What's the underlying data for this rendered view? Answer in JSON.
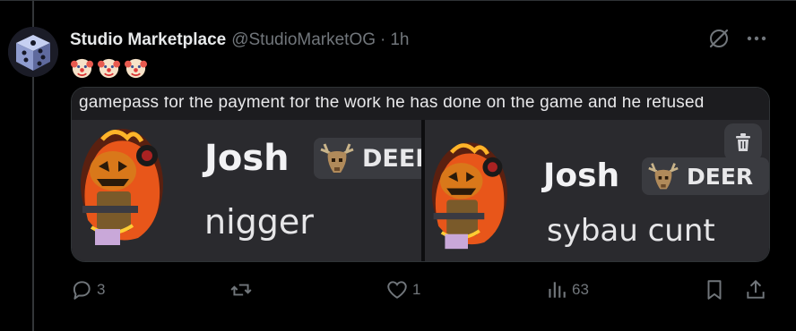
{
  "post": {
    "display_name": "Studio Marketplace",
    "handle": "@StudioMarketOG",
    "separator": "·",
    "time": "1h",
    "emojis": [
      "clown-face",
      "clown-face",
      "clown-face"
    ]
  },
  "media": {
    "caption_strip": "gamepass for the payment for the work he has done on the game and he refused",
    "left_message": {
      "name": "Josh",
      "role": "DEEI",
      "text": "nigger"
    },
    "right_message": {
      "name": "Josh",
      "role": "DEER",
      "text": "sybau cunt"
    }
  },
  "actions": {
    "replies": "3",
    "reposts": "",
    "likes": "1",
    "views": "63"
  },
  "icons": {
    "header": [
      "grok-icon",
      "more-icon"
    ],
    "actions": [
      "reply-icon",
      "repost-icon",
      "like-icon",
      "views-icon",
      "bookmark-icon",
      "share-icon"
    ],
    "media": [
      "trash-icon"
    ]
  },
  "colors": {
    "background": "#000000",
    "text_primary": "#e7e9ea",
    "text_secondary": "#71767b",
    "border": "#2f3336",
    "message_panel": "#2a2a2e"
  }
}
